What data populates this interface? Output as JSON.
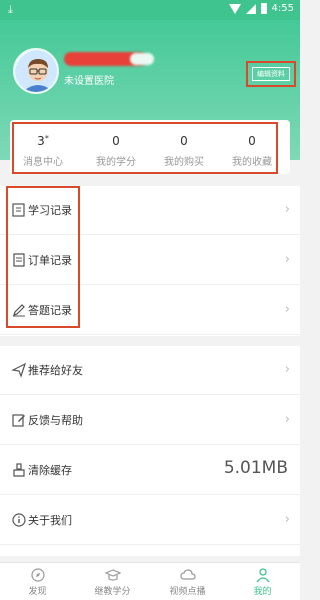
{
  "status_bar": {
    "time": "4:55",
    "download_icon": "download-icon"
  },
  "profile": {
    "hospital": "未设置医院",
    "edit_label": "编辑资料"
  },
  "stats": [
    {
      "value": "3",
      "label": "消息中心",
      "has_dot": true
    },
    {
      "value": "0",
      "label": "我的学分"
    },
    {
      "value": "0",
      "label": "我的购买"
    },
    {
      "value": "0",
      "label": "我的收藏"
    }
  ],
  "menu_group1": [
    {
      "label": "学习记录",
      "icon": "notebook-icon"
    },
    {
      "label": "订单记录",
      "icon": "receipt-icon"
    },
    {
      "label": "答题记录",
      "icon": "pencil-icon"
    }
  ],
  "menu_group2": [
    {
      "label": "推荐给好友",
      "icon": "send-icon"
    },
    {
      "label": "反馈与帮助",
      "icon": "edit-icon"
    },
    {
      "label": "清除缓存",
      "icon": "broom-icon",
      "value": "5.01MB"
    },
    {
      "label": "关于我们",
      "icon": "info-icon"
    }
  ],
  "tabs": [
    {
      "label": "发现",
      "icon": "compass-icon",
      "active": false
    },
    {
      "label": "继教学分",
      "icon": "graduation-cap-icon",
      "active": false
    },
    {
      "label": "视频点播",
      "icon": "cloud-icon",
      "active": false
    },
    {
      "label": "我的",
      "icon": "user-icon",
      "active": true
    }
  ],
  "colors": {
    "brand_green": "#3fc48f",
    "highlight_red": "#d84a2a"
  }
}
